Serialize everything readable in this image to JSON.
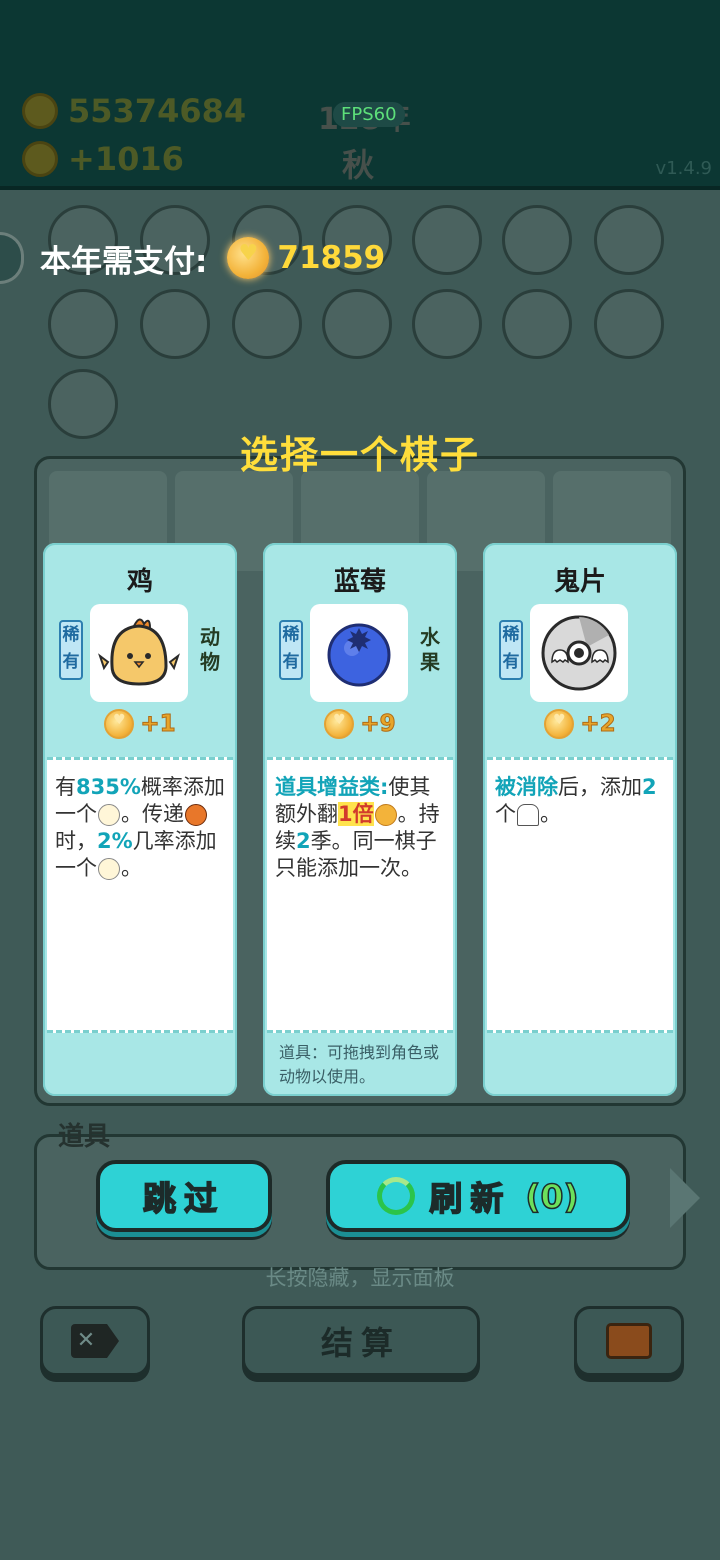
{
  "hud": {
    "coins": "55374684",
    "income": "+1016",
    "year": "128年",
    "season": "秋",
    "fps": "FPS60",
    "version": "v1.4.9"
  },
  "payment": {
    "label": "本年需支付:",
    "amount": "71859"
  },
  "title": "选择一个棋子",
  "cards": [
    {
      "name": "鸡",
      "rarity": "稀有",
      "category": "动物",
      "price": "+1",
      "desc": {
        "p1": "有",
        "h1": "835%",
        "p2": "概率添加一个",
        "p3": "。传递",
        "p4": "时，",
        "h2": "2%",
        "p5": "几率添加一个",
        "p6": "。"
      }
    },
    {
      "name": "蓝莓",
      "rarity": "稀有",
      "category": "水果",
      "price": "+9",
      "desc": {
        "h1": "道具增益类:",
        "p1": "使其额外翻",
        "h2": "1倍",
        "p2": "。持续",
        "h3": "2",
        "p3": "季。同一棋子只能添加一次。"
      },
      "note": "道具：可拖拽到角色或动物以使用。"
    },
    {
      "name": "鬼片",
      "rarity": "稀有",
      "category": "",
      "price": "+2",
      "desc": {
        "h1": "被消除",
        "p1": "后，添加",
        "h2": "2",
        "p2": "个",
        "p3": "。"
      }
    }
  ],
  "items_label": "道具",
  "buttons": {
    "skip": "跳过",
    "refresh": "刷新",
    "refresh_count": "(0)",
    "settle": "结算"
  },
  "hint": "长按隐藏，显示面板",
  "icons": {
    "coin": "coin-heart-icon",
    "refresh": "refresh-arrows-icon",
    "delete": "delete-icon",
    "suitcase": "suitcase-icon"
  }
}
